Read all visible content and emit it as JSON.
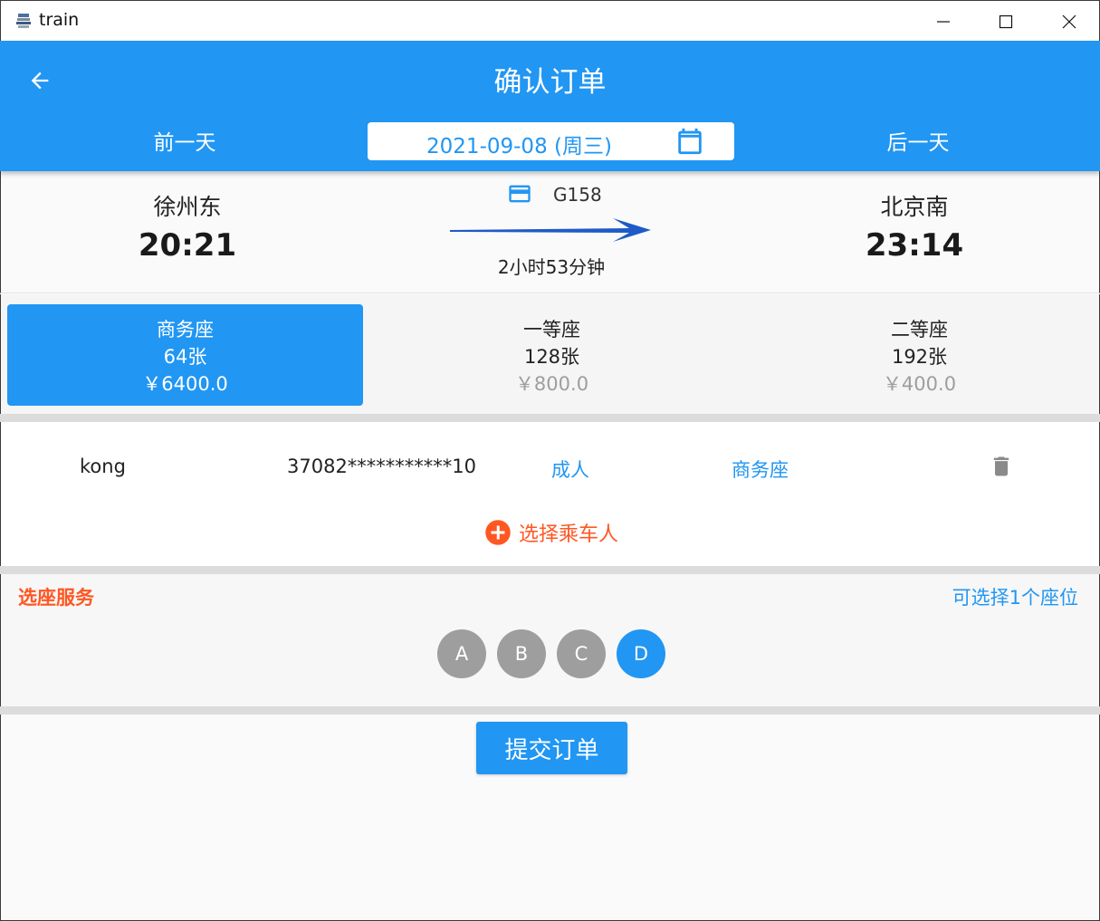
{
  "window": {
    "title": "train"
  },
  "header": {
    "title": "确认订单",
    "prev_day": "前一天",
    "next_day": "后一天",
    "date": "2021-09-08 (周三)"
  },
  "train": {
    "from_station": "徐州东",
    "from_time": "20:21",
    "to_station": "北京南",
    "to_time": "23:14",
    "number": "G158",
    "duration": "2小时53分钟"
  },
  "seat_types": [
    {
      "name": "商务座",
      "count": "64张",
      "price": "￥6400.0",
      "selected": true
    },
    {
      "name": "一等座",
      "count": "128张",
      "price": "￥800.0",
      "selected": false
    },
    {
      "name": "二等座",
      "count": "192张",
      "price": "￥400.0",
      "selected": false
    }
  ],
  "passengers": [
    {
      "name": "kong",
      "id_number": "37082***********10",
      "ticket_type": "成人",
      "seat_type": "商务座"
    }
  ],
  "add_passenger_label": "选择乘车人",
  "seat_selection": {
    "title": "选座服务",
    "hint": "可选择1个座位",
    "seats": [
      {
        "label": "A",
        "selected": false
      },
      {
        "label": "B",
        "selected": false
      },
      {
        "label": "C",
        "selected": false
      },
      {
        "label": "D",
        "selected": true
      }
    ]
  },
  "submit_label": "提交订单",
  "colors": {
    "primary": "#2196f3",
    "accent": "#ff5722",
    "inactive_seat": "#9e9e9e"
  }
}
